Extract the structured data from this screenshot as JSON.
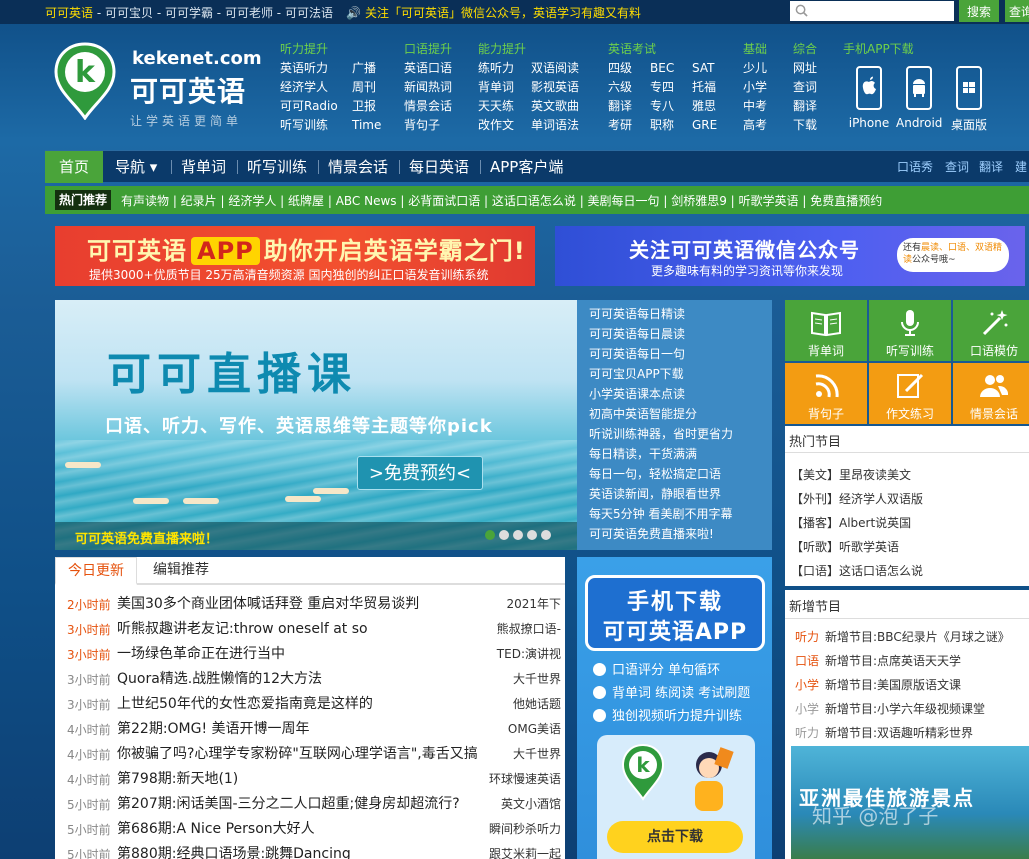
{
  "topbar": {
    "links": [
      "可可英语",
      "可可宝贝",
      "可可学霸",
      "可可老师",
      "可可法语"
    ],
    "separator": " - ",
    "notice": "关注「可可英语」微信公众号，英语学习有趣又有料",
    "search_placeholder": "",
    "search_button": "搜索",
    "search_button2": "查询"
  },
  "logo": {
    "domain": "kekenet.com",
    "name": "可可英语",
    "slogan": "让学英语更简单"
  },
  "nav_columns": [
    {
      "heading": "听力提升",
      "rows": [
        [
          "英语听力",
          "广播"
        ],
        [
          "经济学人",
          "周刊"
        ],
        [
          "可可Radio",
          "卫报"
        ],
        [
          "听写训练",
          "Time"
        ]
      ]
    },
    {
      "heading": "口语提升",
      "rows": [
        [
          "英语口语"
        ],
        [
          "新闻热词"
        ],
        [
          "情景会话"
        ],
        [
          "背句子"
        ]
      ]
    },
    {
      "heading": "能力提升",
      "rows": [
        [
          "练听力",
          "双语阅读"
        ],
        [
          "背单词",
          "影视英语"
        ],
        [
          "天天练",
          "英文歌曲"
        ],
        [
          "改作文",
          "单词语法"
        ]
      ]
    },
    {
      "heading": "英语考试",
      "rows": [
        [
          "四级",
          "BEC",
          "SAT"
        ],
        [
          "六级",
          "专四",
          "托福"
        ],
        [
          "翻译",
          "专八",
          "雅思"
        ],
        [
          "考研",
          "职称",
          "GRE"
        ]
      ]
    },
    {
      "heading": "基础",
      "rows": [
        [
          "少儿"
        ],
        [
          "小学"
        ],
        [
          "中考"
        ],
        [
          "高考"
        ]
      ]
    },
    {
      "heading": "综合",
      "rows": [
        [
          "网址"
        ],
        [
          "查词"
        ],
        [
          "翻译"
        ],
        [
          "下载"
        ]
      ]
    }
  ],
  "app_download": {
    "heading": "手机APP下载",
    "items": [
      "iPhone",
      "Android",
      "桌面版"
    ]
  },
  "main_nav": {
    "items": [
      "首页",
      "导航 ▾",
      "背单词",
      "听写训练",
      "情景会话",
      "每日英语",
      "APP客户端"
    ],
    "right": [
      "口语秀",
      "查词",
      "翻译",
      "建"
    ]
  },
  "hot": {
    "tag": "热门推荐",
    "items": "有声读物 | 纪录片 | 经济学人 | 纸牌屋 | ABC News | 必背面试口语 | 这话口语怎么说 | 美剧每日一句 | 剑桥雅思9 | 听歌学英语 | 免费直播预约"
  },
  "banner1": {
    "pre": "可可英语",
    "app": "APP",
    "post": "助你开启英语学霸之门!",
    "sub": "提供3000+优质节目  25万高清音频资源  国内独创的纠正口语发音训练系统"
  },
  "banner2": {
    "title": "关注可可英语微信公众号",
    "sub": "更多趣味有料的学习资讯等你来发现",
    "bubble_a": "还有",
    "bubble_b": "晨读、口语、双语精读",
    "bubble_c": "公众号哦~"
  },
  "hero": {
    "title": "可可直播课",
    "subtitle": "口语、听力、写作、英语思维等主题等你pick",
    "button": ">免费预约<",
    "caption": "可可英语免费直播来啦！"
  },
  "hero_list": [
    "可可英语每日精读",
    "可可英语每日晨读",
    "可可英语每日一句",
    "可可宝贝APP下载",
    "小学英语课本点读",
    "初高中英语智能提分",
    "听说训练神器，省时更省力",
    "每日精读，干货满满",
    "每日一句，轻松搞定口语",
    "英语读新闻，静眼看世界",
    "每天5分钟 看美剧不用字幕",
    "可可英语免费直播来啦!"
  ],
  "tiles": [
    {
      "label": "背单词",
      "icon": "book-icon",
      "color": "#4aa43a"
    },
    {
      "label": "听写训练",
      "icon": "microphone-icon",
      "color": "#4aa43a"
    },
    {
      "label": "口语模仿",
      "icon": "magic-wand-icon",
      "color": "#4aa43a"
    },
    {
      "label": "背句子",
      "icon": "rss-icon",
      "color": "#f39c12"
    },
    {
      "label": "作文练习",
      "icon": "pencil-icon",
      "color": "#f39c12"
    },
    {
      "label": "情景会话",
      "icon": "users-icon",
      "color": "#f39c12"
    }
  ],
  "hot_programs": {
    "heading": "热门节目",
    "items": [
      "【美文】里昂夜读美文",
      "【外刊】经济学人双语版",
      "【播客】Albert说英国",
      "【听歌】听歌学英语",
      "【口语】这话口语怎么说"
    ]
  },
  "new_programs": {
    "heading": "新增节目",
    "items": [
      {
        "cat": "听力",
        "text": "新增节目:BBC纪录片《月球之谜》",
        "color": "#e5520e"
      },
      {
        "cat": "口语",
        "text": "新增节目:点席英语天天学",
        "color": "#e5520e"
      },
      {
        "cat": "小学",
        "text": "新增节目:美国原版语文课",
        "color": "#e5520e"
      },
      {
        "cat": "小学",
        "text": "新增节目:小学六年级视频课堂",
        "color": "#999999"
      },
      {
        "cat": "听力",
        "text": "新增节目:双语趣听精彩世界",
        "color": "#999999"
      }
    ],
    "image_title": "亚洲最佳旅游景点",
    "watermark": "知乎 @泡了子"
  },
  "news": {
    "tabs": [
      "今日更新",
      "编辑推荐"
    ],
    "rows": [
      {
        "time": "2小时前",
        "title": "美国30多个商业团体喊话拜登 重启对华贸易谈判",
        "src": "2021年下",
        "red": true
      },
      {
        "time": "3小时前",
        "title": "听熊叔趣讲老友记:throw oneself at so",
        "src": "熊叔撩口语-",
        "red": true
      },
      {
        "time": "3小时前",
        "title": "一场绿色革命正在进行当中",
        "src": "TED:演讲视",
        "red": true
      },
      {
        "time": "3小时前",
        "title": "Quora精选.战胜懒惰的12大方法",
        "src": "大千世界",
        "red": false
      },
      {
        "time": "3小时前",
        "title": "上世纪50年代的女性恋爱指南竟是这样的",
        "src": "他她话题",
        "red": false
      },
      {
        "time": "4小时前",
        "title": "第22期:OMG! 美语开博一周年",
        "src": "OMG美语",
        "red": false
      },
      {
        "time": "4小时前",
        "title": "你被骗了吗?心理学专家粉碎\"互联网心理学语言\",毒舌又搞",
        "src": "大千世界",
        "red": false
      },
      {
        "time": "4小时前",
        "title": "第798期:新天地(1)",
        "src": "环球慢速英语",
        "red": false
      },
      {
        "time": "5小时前",
        "title": "第207期:闲话美国-三分之二人口超重;健身房却超流行?",
        "src": "英文小酒馆",
        "red": false
      },
      {
        "time": "5小时前",
        "title": "第686期:A Nice Person大好人",
        "src": "瞬间秒杀听力",
        "red": false
      },
      {
        "time": "5小时前",
        "title": "第880期:经典口语场景:跳舞Dancing",
        "src": "跟艾米莉一起",
        "red": false
      }
    ]
  },
  "promo": {
    "line1": "手机下载",
    "line2": "可可英语APP",
    "features": [
      "口语评分  单句循环",
      "背单词  练阅读  考试刷题",
      "独创视频听力提升训练"
    ],
    "download": "点击下载"
  }
}
